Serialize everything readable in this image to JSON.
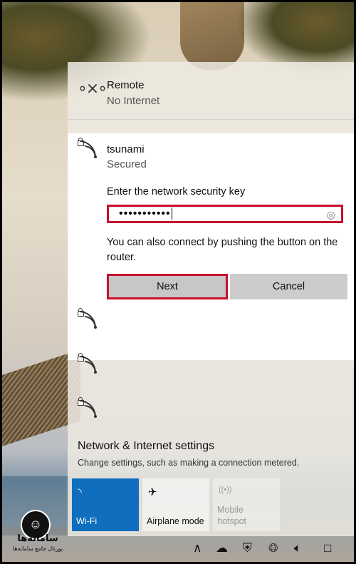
{
  "networks": {
    "remote": {
      "name": "Remote",
      "status": "No Internet",
      "icon": "ethernet-icon"
    },
    "selected": {
      "name": "tsunami",
      "status": "Secured",
      "prompt": "Enter the network security key",
      "password_mask": "•••••••••••",
      "hint": "You can also connect by pushing the button on the router.",
      "next_label": "Next",
      "cancel_label": "Cancel"
    }
  },
  "settings": {
    "title": "Network & Internet settings",
    "subtitle": "Change settings, such as making a connection metered."
  },
  "quick_actions": {
    "wifi": "Wi-Fi",
    "airplane": "Airplane mode",
    "hotspot_line1": "Mobile",
    "hotspot_line2": "hotspot"
  },
  "watermark": {
    "title": "سامانه‌ها",
    "subtitle": "پورتال جامع سامانه‌ها"
  },
  "colors": {
    "accent": "#0f6ebd",
    "highlight": "#c8102e"
  }
}
